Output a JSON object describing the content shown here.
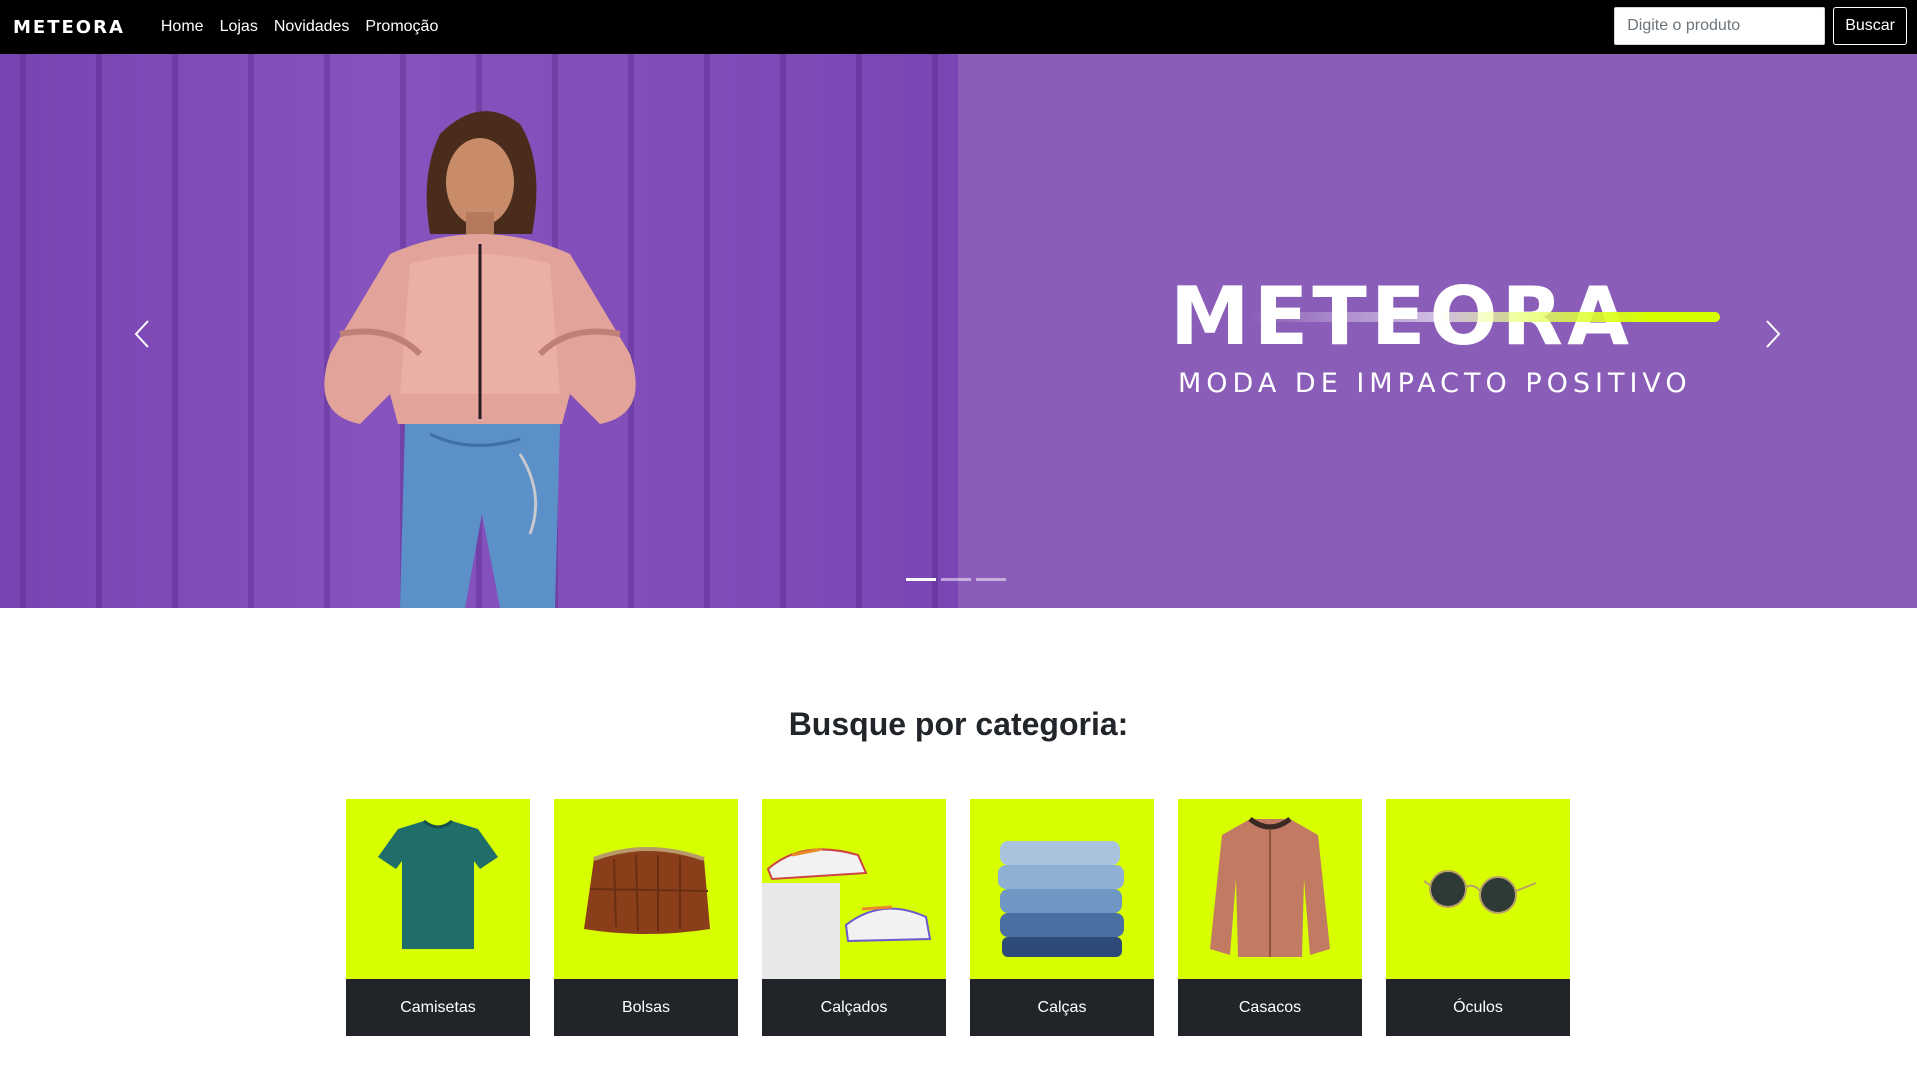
{
  "brand": {
    "logo_text": "METEORA",
    "accent_color": "#d7ff00",
    "hero_bg_color": "#8a5eb8"
  },
  "nav": {
    "links": [
      "Home",
      "Lojas",
      "Novidades",
      "Promoção"
    ]
  },
  "search": {
    "placeholder": "Digite o produto",
    "value": "",
    "button_label": "Buscar"
  },
  "hero": {
    "title": "METEORA",
    "subtitle": "MODA DE IMPACTO POSITIVO",
    "prev_icon": "chevron-left-icon",
    "next_icon": "chevron-right-icon",
    "slide_count": 3,
    "active_slide": 1
  },
  "categories": {
    "heading": "Busque por categoria:",
    "items": [
      {
        "label": "Camisetas",
        "icon": "tshirt-image"
      },
      {
        "label": "Bolsas",
        "icon": "handbag-image"
      },
      {
        "label": "Calçados",
        "icon": "sneakers-image"
      },
      {
        "label": "Calças",
        "icon": "jeans-image"
      },
      {
        "label": "Casacos",
        "icon": "jacket-image"
      },
      {
        "label": "Óculos",
        "icon": "sunglasses-image"
      }
    ]
  }
}
